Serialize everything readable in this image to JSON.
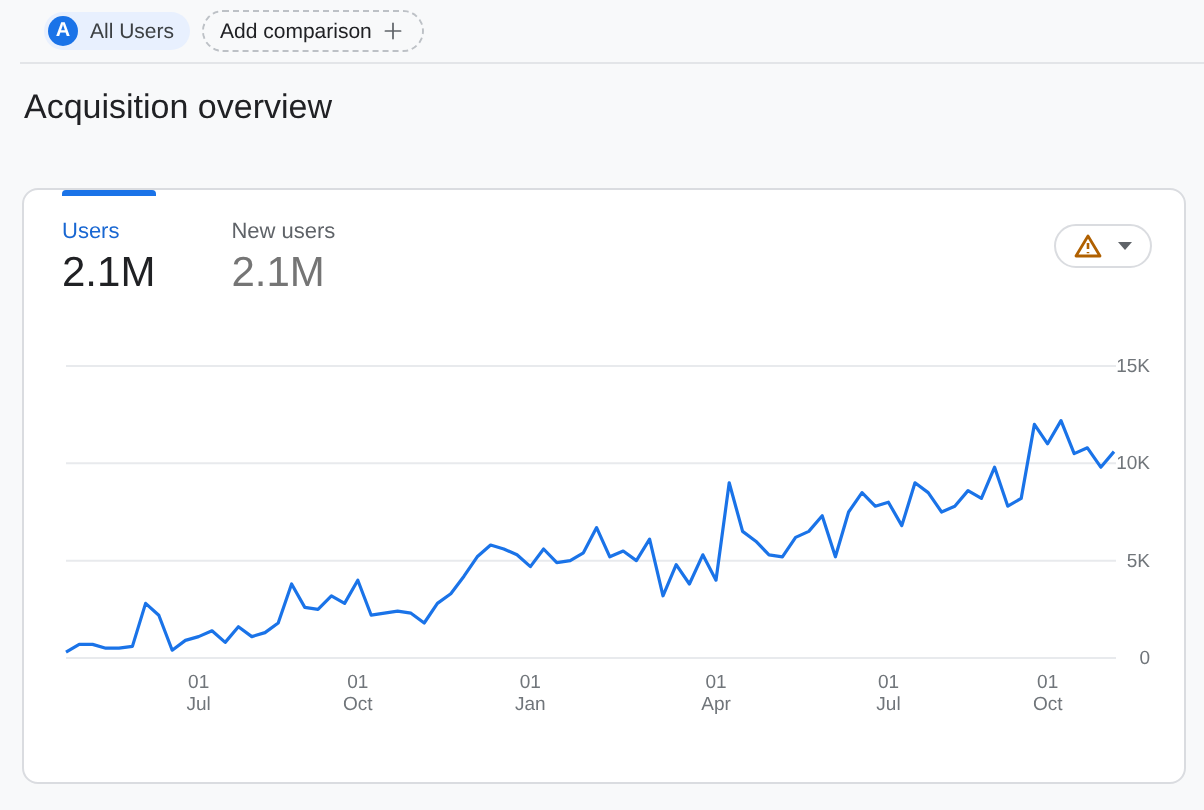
{
  "audience_chip": {
    "avatar": "A",
    "label": "All Users"
  },
  "add_comparison_button": {
    "label": "Add comparison"
  },
  "page_title": "Acquisition overview",
  "card": {
    "tabs": [
      {
        "label": "Users",
        "value": "2.1M",
        "selected": true
      },
      {
        "label": "New users",
        "value": "2.1M",
        "selected": false
      }
    ],
    "chart_data": {
      "type": "line",
      "categories": [
        null,
        null,
        null,
        null,
        null,
        null,
        null,
        null,
        null,
        null,
        "01 Jul",
        null,
        null,
        null,
        null,
        null,
        null,
        null,
        null,
        null,
        null,
        null,
        "01 Oct",
        null,
        null,
        null,
        null,
        null,
        null,
        null,
        null,
        null,
        null,
        null,
        null,
        "01 Jan",
        null,
        null,
        null,
        null,
        null,
        null,
        null,
        null,
        null,
        null,
        null,
        null,
        null,
        "01 Apr",
        null,
        null,
        null,
        null,
        null,
        null,
        null,
        null,
        null,
        null,
        null,
        null,
        "01 Jul",
        null,
        null,
        null,
        null,
        null,
        null,
        null,
        null,
        null,
        null,
        null,
        "01 Oct",
        null,
        null,
        null,
        null,
        null
      ],
      "series": [
        {
          "color": "#1a73e8",
          "values": [
            0.3,
            0.7,
            0.7,
            0.5,
            0.5,
            0.6,
            2.8,
            2.2,
            0.4,
            0.9,
            1.1,
            1.4,
            0.8,
            1.6,
            1.1,
            1.3,
            1.8,
            3.8,
            2.6,
            2.5,
            3.2,
            2.8,
            4.0,
            2.2,
            2.3,
            2.4,
            2.3,
            1.8,
            2.8,
            3.3,
            4.2,
            5.2,
            5.8,
            5.6,
            5.3,
            4.7,
            5.6,
            4.9,
            5.0,
            5.4,
            6.7,
            5.2,
            5.5,
            5.0,
            6.1,
            3.2,
            4.8,
            3.8,
            5.3,
            4.0,
            9.0,
            6.5,
            6.0,
            5.3,
            5.2,
            6.2,
            6.5,
            7.3,
            5.2,
            7.5,
            8.5,
            7.8,
            8.0,
            6.8,
            9.0,
            8.5,
            7.5,
            7.8,
            8.6,
            8.2,
            9.8,
            7.8,
            8.2,
            12.0,
            11.0,
            12.2,
            10.5,
            10.8,
            9.8,
            10.6
          ]
        }
      ],
      "ylim": [
        0,
        15
      ],
      "yticks": [
        {
          "value": 0,
          "label": "0"
        },
        {
          "value": 5,
          "label": "5K"
        },
        {
          "value": 10,
          "label": "10K"
        },
        {
          "value": 15,
          "label": "15K"
        }
      ]
    }
  }
}
